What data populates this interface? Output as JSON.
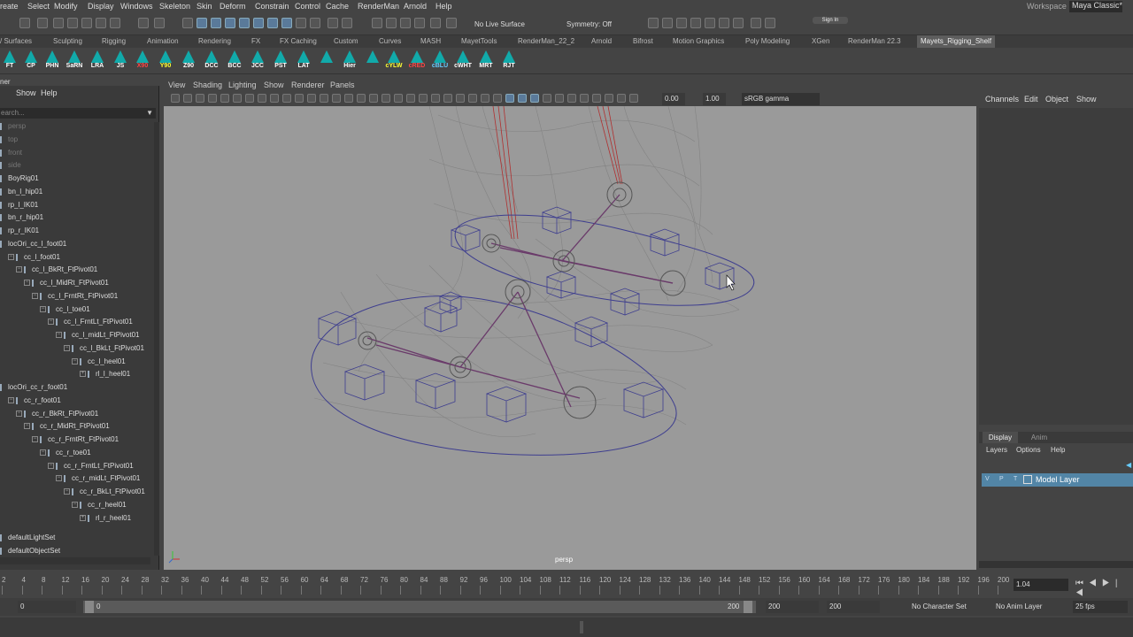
{
  "menubar": {
    "items": [
      "reate",
      "Select",
      "Modify",
      "Display",
      "Windows",
      "Skeleton",
      "Skin",
      "Deform",
      "Constrain",
      "Control",
      "Cache",
      "RenderMan",
      "Arnold",
      "Help"
    ],
    "workspace_label": "Workspace :",
    "workspace_value": "Maya Classic*"
  },
  "statusline": {
    "live_surface": "No Live Surface",
    "symmetry": "Symmetry: Off",
    "sign_in": "Sign In"
  },
  "shelf_tabs": [
    "/ Surfaces",
    "Sculpting",
    "Rigging",
    "Animation",
    "Rendering",
    "FX",
    "FX Caching",
    "Custom",
    "Curves",
    "MASH",
    "MayetTools",
    "RenderMan_22_2",
    "Arnold",
    "Bifrost",
    "Motion Graphics",
    "Poly Modeling",
    "XGen",
    "RenderMan 22.3",
    "Mayets_Rigging_Shelf"
  ],
  "active_shelf": "Mayets_Rigging_Shelf",
  "shelf_buttons": [
    {
      "label": "FT",
      "color": "white"
    },
    {
      "label": "CP",
      "color": "white"
    },
    {
      "label": "PHN",
      "color": "white"
    },
    {
      "label": "SaRN",
      "color": "white"
    },
    {
      "label": "LRA",
      "color": "white"
    },
    {
      "label": "JS",
      "color": "white"
    },
    {
      "label": "X90",
      "color": "red"
    },
    {
      "label": "Y90",
      "color": "yellow"
    },
    {
      "label": "Z90",
      "color": "white"
    },
    {
      "label": "DCC",
      "color": "white"
    },
    {
      "label": "BCC",
      "color": "white"
    },
    {
      "label": "JCC",
      "color": "white"
    },
    {
      "label": "PST",
      "color": "white"
    },
    {
      "label": "LAT",
      "color": "white"
    },
    {
      "label": "",
      "color": "white"
    },
    {
      "label": "Hier",
      "color": "white"
    },
    {
      "label": "",
      "color": "white"
    },
    {
      "label": "cYLW",
      "color": "yellow"
    },
    {
      "label": "cRED",
      "color": "red"
    },
    {
      "label": "cBLU",
      "color": "blue"
    },
    {
      "label": "cWHT",
      "color": "white"
    },
    {
      "label": "MRT",
      "color": "white"
    },
    {
      "label": "RJT",
      "color": "white"
    }
  ],
  "outliner": {
    "title": "ner",
    "menu": [
      "Show",
      "Help"
    ],
    "search_placeholder": "earch...",
    "rows": [
      {
        "label": "persp",
        "indent": 0,
        "dim": true,
        "tri": ""
      },
      {
        "label": "top",
        "indent": 0,
        "dim": true,
        "tri": ""
      },
      {
        "label": "front",
        "indent": 0,
        "dim": true,
        "tri": ""
      },
      {
        "label": "side",
        "indent": 0,
        "dim": true,
        "tri": ""
      },
      {
        "label": "BoyRig01",
        "indent": 0,
        "dim": false,
        "tri": ""
      },
      {
        "label": "bn_l_hip01",
        "indent": 0,
        "dim": false,
        "tri": ""
      },
      {
        "label": "rp_l_IK01",
        "indent": 0,
        "dim": false,
        "tri": ""
      },
      {
        "label": "bn_r_hip01",
        "indent": 0,
        "dim": false,
        "tri": ""
      },
      {
        "label": "rp_r_IK01",
        "indent": 0,
        "dim": false,
        "tri": ""
      },
      {
        "label": "locOri_cc_l_foot01",
        "indent": 0,
        "dim": false,
        "tri": ""
      },
      {
        "label": "cc_l_foot01",
        "indent": 1,
        "dim": false,
        "tri": "−"
      },
      {
        "label": "cc_l_BkRt_FtPivot01",
        "indent": 2,
        "dim": false,
        "tri": "−"
      },
      {
        "label": "cc_l_MidRt_FtPivot01",
        "indent": 3,
        "dim": false,
        "tri": "−"
      },
      {
        "label": "cc_l_FrntRt_FtPivot01",
        "indent": 4,
        "dim": false,
        "tri": "−"
      },
      {
        "label": "cc_l_toe01",
        "indent": 5,
        "dim": false,
        "tri": "−"
      },
      {
        "label": "cc_l_FrntLt_FtPivot01",
        "indent": 6,
        "dim": false,
        "tri": "−"
      },
      {
        "label": "cc_l_midLt_FtPivot01",
        "indent": 7,
        "dim": false,
        "tri": "−"
      },
      {
        "label": "cc_l_BkLt_FtPivot01",
        "indent": 8,
        "dim": false,
        "tri": "−"
      },
      {
        "label": "cc_l_heel01",
        "indent": 9,
        "dim": false,
        "tri": "−"
      },
      {
        "label": "rl_l_heel01",
        "indent": 10,
        "dim": false,
        "tri": "+"
      },
      {
        "label": "locOri_cc_r_foot01",
        "indent": 0,
        "dim": false,
        "tri": ""
      },
      {
        "label": "cc_r_foot01",
        "indent": 1,
        "dim": false,
        "tri": "−"
      },
      {
        "label": "cc_r_BkRt_FtPivot01",
        "indent": 2,
        "dim": false,
        "tri": "−"
      },
      {
        "label": "cc_r_MidRt_FtPivot01",
        "indent": 3,
        "dim": false,
        "tri": "−"
      },
      {
        "label": "cc_r_FrntRt_FtPivot01",
        "indent": 4,
        "dim": false,
        "tri": "−"
      },
      {
        "label": "cc_r_toe01",
        "indent": 5,
        "dim": false,
        "tri": "−"
      },
      {
        "label": "cc_r_FrntLt_FtPivot01",
        "indent": 6,
        "dim": false,
        "tri": "−"
      },
      {
        "label": "cc_r_midLt_FtPivot01",
        "indent": 7,
        "dim": false,
        "tri": "−"
      },
      {
        "label": "cc_r_BkLt_FtPivot01",
        "indent": 8,
        "dim": false,
        "tri": "−"
      },
      {
        "label": "cc_r_heel01",
        "indent": 9,
        "dim": false,
        "tri": "−"
      },
      {
        "label": "rl_r_heel01",
        "indent": 10,
        "dim": false,
        "tri": "+"
      },
      {
        "label": "defaultLightSet",
        "indent": 0,
        "dim": false,
        "tri": ""
      },
      {
        "label": "defaultObjectSet",
        "indent": 0,
        "dim": false,
        "tri": ""
      }
    ]
  },
  "viewport": {
    "menu": [
      "View",
      "Shading",
      "Lighting",
      "Show",
      "Renderer",
      "Panels"
    ],
    "exposure": "0.00",
    "gamma": "1.00",
    "color_space": "sRGB gamma",
    "camera_label": "persp"
  },
  "channel_box": {
    "menu": [
      "Channels",
      "Edit",
      "Object",
      "Show"
    ]
  },
  "layer_editor": {
    "tabs": [
      "Display",
      "Anim"
    ],
    "active_tab": "Display",
    "menu": [
      "Layers",
      "Options",
      "Help"
    ],
    "layer": {
      "v": "V",
      "p": "P",
      "t": "T",
      "name": "Model Layer"
    }
  },
  "timeline": {
    "ticks": [
      "2",
      "4",
      "8",
      "12",
      "16",
      "20",
      "24",
      "28",
      "32",
      "36",
      "40",
      "44",
      "48",
      "52",
      "56",
      "60",
      "64",
      "68",
      "72",
      "76",
      "80",
      "84",
      "88",
      "92",
      "96",
      "100",
      "104",
      "108",
      "112",
      "116",
      "120",
      "124",
      "128",
      "132",
      "136",
      "140",
      "144",
      "148",
      "152",
      "156",
      "160",
      "164",
      "168",
      "172",
      "176",
      "180",
      "184",
      "188",
      "192",
      "196",
      "200"
    ],
    "current_frame": "1.04"
  },
  "range": {
    "start": "0",
    "inner_start": "0",
    "inner_end": "200",
    "end": "200",
    "outer_end": "200",
    "character_set": "No Character Set",
    "anim_layer": "No Anim Layer",
    "fps": "25 fps"
  },
  "colors": {
    "accent": "#5285a6",
    "viewport_bg": "#9a9a9a",
    "wire_blue": "#3e3e8f",
    "wire_red": "#b03030"
  }
}
